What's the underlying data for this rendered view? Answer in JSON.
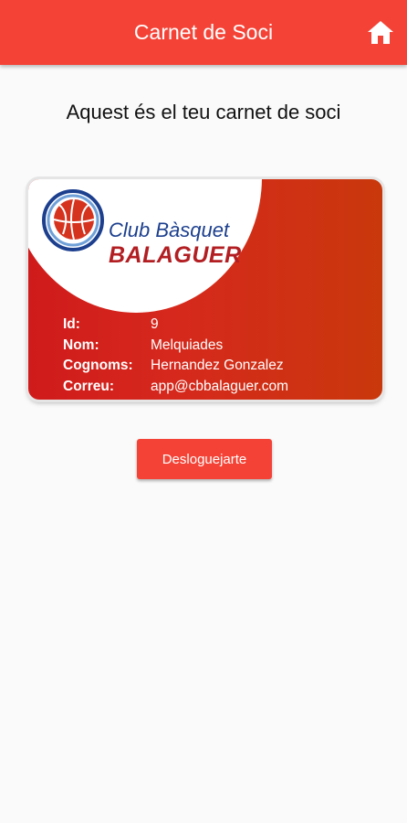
{
  "app_bar": {
    "title": "Carnet de Soci",
    "home_icon": "home-icon",
    "color": "#f44336"
  },
  "heading": "Aquest és el teu carnet de soci",
  "card": {
    "logo": {
      "club_line": "Club Bàsquet",
      "city_line": "BALAGUER",
      "icon": "basketball-icon"
    },
    "fields": [
      {
        "label": "Id:",
        "value": "9"
      },
      {
        "label": "Nom:",
        "value": "Melquiades"
      },
      {
        "label": "Cognoms:",
        "value": "Hernandez Gonzalez"
      },
      {
        "label": "Correu:",
        "value": "app@cbbalaguer.com"
      }
    ],
    "gradient": [
      "#cf1b1b",
      "#c9380c"
    ]
  },
  "logout_button": {
    "label": "Desloguejarte"
  }
}
